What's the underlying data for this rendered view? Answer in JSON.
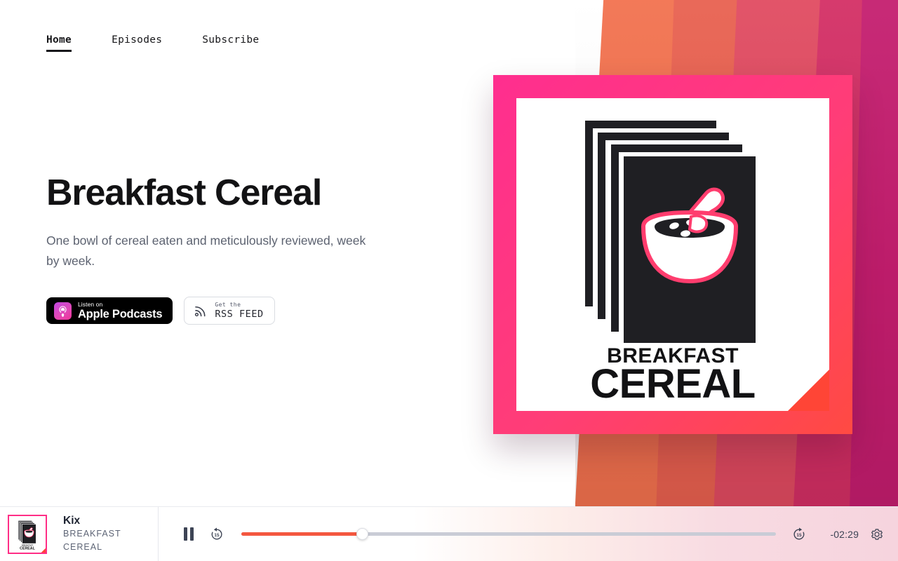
{
  "nav": {
    "items": [
      {
        "label": "Home",
        "active": true
      },
      {
        "label": "Episodes",
        "active": false
      },
      {
        "label": "Subscribe",
        "active": false
      }
    ]
  },
  "hero": {
    "title": "Breakfast Cereal",
    "subtitle": "One bowl of cereal eaten and meticulously reviewed, week by week.",
    "apple_badge": {
      "small": "Listen on",
      "large": "Apple Podcasts",
      "icon": "apple-podcasts-icon"
    },
    "rss_badge": {
      "small": "Get the",
      "large": "RSS FEED",
      "icon": "rss-icon"
    }
  },
  "artwork": {
    "title_top": "BREAKFAST",
    "title_bottom": "CEREAL",
    "frame_color": "#ff2d87",
    "accent_color": "#ff4136",
    "card_color": "#1f1f23",
    "bowl_outline": "#ff3d6e"
  },
  "player": {
    "track_title": "Kix",
    "show_name_line1": "BREAKFAST",
    "show_name_line2": "CEREAL",
    "time_remaining": "-02:29",
    "progress_percent": 22.6,
    "pause_icon": "pause-icon",
    "rewind_label": "15",
    "forward_label": "15",
    "settings_icon": "gear-icon",
    "fill_color": "#f4573f",
    "track_color": "#c9ccd6"
  },
  "background": {
    "bands": [
      "#f2714e",
      "#e8604f",
      "#e04a60",
      "#d32e64",
      "#c41d6e"
    ]
  }
}
